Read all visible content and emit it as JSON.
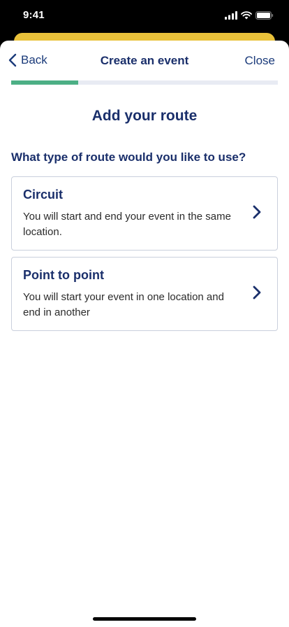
{
  "status_bar": {
    "time": "9:41"
  },
  "nav": {
    "back_label": "Back",
    "title": "Create an event",
    "close_label": "Close"
  },
  "progress": {
    "fraction": 0.25
  },
  "content": {
    "heading": "Add your route",
    "question": "What type of route would you like to use?",
    "options": [
      {
        "title": "Circuit",
        "description": "You will start and end your event in the same location."
      },
      {
        "title": "Point to point",
        "description": "You will start your event in one location and end in another"
      }
    ]
  },
  "colors": {
    "brand_navy": "#1a2f6b",
    "progress_green": "#4caf85",
    "accent_yellow": "#e9c13a"
  }
}
